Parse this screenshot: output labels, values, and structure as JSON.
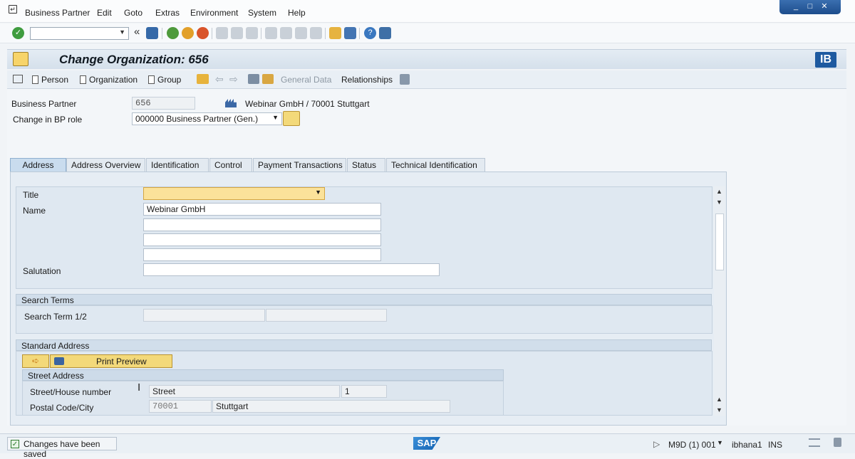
{
  "menu": [
    "Business Partner",
    "Edit",
    "Goto",
    "Extras",
    "Environment",
    "System",
    "Help"
  ],
  "window": {
    "minimize": "_",
    "restore": "□",
    "close": "✕"
  },
  "toolbar": {
    "back_chevrons": "«",
    "command_value": ""
  },
  "page": {
    "title": "Change Organization: 656",
    "logo": "IB"
  },
  "app_toolbar": {
    "person": "Person",
    "organization": "Organization",
    "group": "Group",
    "general_data": "General Data",
    "relationships": "Relationships"
  },
  "header": {
    "bp_label": "Business Partner",
    "bp_value": "656",
    "bp_desc": "Webinar GmbH / 70001 Stuttgart",
    "role_label": "Change in BP role",
    "role_value": "000000 Business Partner (Gen.)"
  },
  "tabs": [
    "Address",
    "Address Overview",
    "Identification",
    "Control",
    "Payment Transactions",
    "Status",
    "Technical Identification"
  ],
  "active_tab": "Address",
  "name_group": {
    "title_label": "Title",
    "title_value": "",
    "name_label": "Name",
    "name1": "Webinar GmbH",
    "name2": "",
    "name3": "",
    "name4": "",
    "salutation_label": "Salutation",
    "salutation_value": ""
  },
  "search_terms": {
    "header": "Search Terms",
    "label": "Search Term 1/2",
    "term1": "",
    "term2": ""
  },
  "standard_address": {
    "header": "Standard Address",
    "print_preview": "Print Preview",
    "street_header": "Street Address",
    "street_label": "Street/House number",
    "street_value": "Street",
    "house_number": "1",
    "postal_label": "Postal Code/City",
    "postal_code": "70001",
    "city": "Stuttgart"
  },
  "status": {
    "message": "Changes have been saved",
    "sap_logo": "SAP",
    "system": "M9D (1) 001",
    "user": "ibhana1",
    "mode": "INS"
  },
  "colors": {
    "accent": "#1e5aa0",
    "required_field": "#fbe29a",
    "active_tab": "#c9dcee"
  }
}
